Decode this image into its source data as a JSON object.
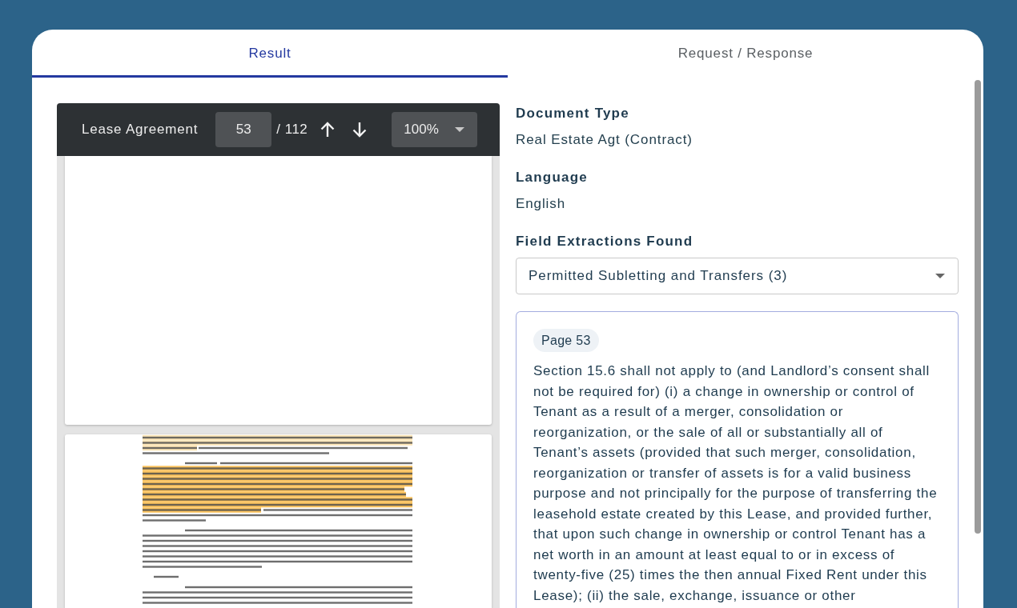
{
  "tabs": [
    {
      "label": "Result",
      "selected": true
    },
    {
      "label": "Request / Response",
      "selected": false
    }
  ],
  "viewer": {
    "title": "Lease Agreement",
    "page_input": {
      "value": "53"
    },
    "page_total": "/ 112",
    "zoom": {
      "value": "100%"
    }
  },
  "details": [
    {
      "label": "Document Type",
      "value": "Real Estate Agt (Contract)"
    },
    {
      "label": "Language",
      "value": "English"
    }
  ],
  "extractions": {
    "label": "Field Extractions Found",
    "select": {
      "value": "Permitted Subletting and Transfers (3)"
    },
    "result": {
      "page": "Page 53",
      "text": "Section 15.6 shall not apply to (and Landlord’s consent shall not be required for) (i) a change in ownership or control of Tenant as a result of a merger, consolidation or reorganization, or the sale of all or substantially all of Tenant’s assets (provided that such merger, consolidation, reorganization or transfer of assets is for a valid business purpose and not principally for the purpose of transferring the leasehold estate created by this Lease, and provided further, that upon such change in ownership or control Tenant has a net worth in an amount at least equal to or in excess of twenty-five (25) times the then annual Fixed Rent under this Lease); (ii) the sale, exchange, issuance or other"
    }
  }
}
